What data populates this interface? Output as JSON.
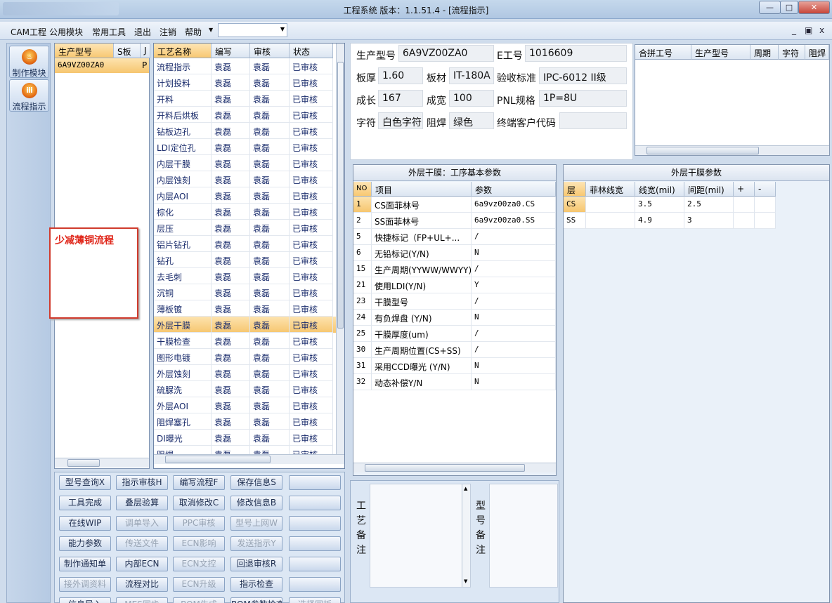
{
  "window": {
    "title": "工程系统  版本：1.1.51.4 - [流程指示]",
    "controls": [
      "—",
      "□",
      "✕"
    ]
  },
  "menubar": {
    "items": [
      "CAM工程",
      "公用模块",
      "常用工具",
      "退出",
      "注销",
      "帮助"
    ],
    "combo_value": "",
    "mdi_controls": [
      "_",
      "▣",
      "x"
    ]
  },
  "toolbar": {
    "items": [
      {
        "label": "制作模块",
        "icon": "flame-icon"
      },
      {
        "label": "流程指示",
        "icon": "flow-icon"
      }
    ]
  },
  "model_list": {
    "headers": [
      "生产型号",
      "S板",
      "J"
    ],
    "rows": [
      [
        "6A9VZ00ZA0",
        "",
        "P"
      ]
    ]
  },
  "note": {
    "text": "少减薄铜流程"
  },
  "process": {
    "headers": [
      "工艺名称",
      "编写",
      "审核",
      "状态"
    ],
    "rows": [
      [
        "流程指示",
        "袁磊",
        "袁磊",
        "已审核"
      ],
      [
        "计划投料",
        "袁磊",
        "袁磊",
        "已审核"
      ],
      [
        "开料",
        "袁磊",
        "袁磊",
        "已审核"
      ],
      [
        "开料后烘板",
        "袁磊",
        "袁磊",
        "已审核"
      ],
      [
        "钻板边孔",
        "袁磊",
        "袁磊",
        "已审核"
      ],
      [
        "LDI定位孔",
        "袁磊",
        "袁磊",
        "已审核"
      ],
      [
        "内层干膜",
        "袁磊",
        "袁磊",
        "已审核"
      ],
      [
        "内层蚀刻",
        "袁磊",
        "袁磊",
        "已审核"
      ],
      [
        "内层AOI",
        "袁磊",
        "袁磊",
        "已审核"
      ],
      [
        "棕化",
        "袁磊",
        "袁磊",
        "已审核"
      ],
      [
        "层压",
        "袁磊",
        "袁磊",
        "已审核"
      ],
      [
        "铝片钻孔",
        "袁磊",
        "袁磊",
        "已审核"
      ],
      [
        "钻孔",
        "袁磊",
        "袁磊",
        "已审核"
      ],
      [
        "去毛刺",
        "袁磊",
        "袁磊",
        "已审核"
      ],
      [
        "沉铜",
        "袁磊",
        "袁磊",
        "已审核"
      ],
      [
        "薄板镀",
        "袁磊",
        "袁磊",
        "已审核"
      ],
      [
        "外层干膜",
        "袁磊",
        "袁磊",
        "已审核"
      ],
      [
        "干膜检查",
        "袁磊",
        "袁磊",
        "已审核"
      ],
      [
        "图形电镀",
        "袁磊",
        "袁磊",
        "已审核"
      ],
      [
        "外层蚀刻",
        "袁磊",
        "袁磊",
        "已审核"
      ],
      [
        "硫脲洗",
        "袁磊",
        "袁磊",
        "已审核"
      ],
      [
        "外层AOI",
        "袁磊",
        "袁磊",
        "已审核"
      ],
      [
        "阻焊塞孔",
        "袁磊",
        "袁磊",
        "已审核"
      ],
      [
        "DI曝光",
        "袁磊",
        "袁磊",
        "已审核"
      ],
      [
        "阻焊",
        "袁磊",
        "袁磊",
        "已审核"
      ]
    ]
  },
  "buttons": [
    [
      "型号查询X",
      "指示审核H",
      "编写流程F",
      "保存信息S",
      ""
    ],
    [
      "工具完成",
      "叠层验算",
      "取消修改C",
      "修改信息B",
      ""
    ],
    [
      "在线WIP",
      "调单导入",
      "PPC审核",
      "型号上网W",
      ""
    ],
    [
      "能力参数",
      "传送文件",
      "ECN影响",
      "发送指示Y",
      ""
    ],
    [
      "制作通知单",
      "内部ECN",
      "ECN文控",
      "回退审核R",
      ""
    ],
    [
      "接外调资料",
      "流程对比",
      "ECN升级",
      "指示检查",
      ""
    ],
    [
      "信息导入",
      "MES同步",
      "BOM生成",
      "BOM参数检查",
      "选择同板"
    ]
  ],
  "info": {
    "labels": {
      "model": "生产型号",
      "e_no": "E工号",
      "thickness": "板厚",
      "material": "板材",
      "standard": "验收标准",
      "length": "成长",
      "width": "成宽",
      "pnl": "PNL规格",
      "char": "字符",
      "mask": "阻焊",
      "customer": "终端客户代码"
    },
    "values": {
      "model": "6A9VZ00ZA0",
      "e_no": "1016609",
      "thickness": "1.60",
      "material": "IT-180A",
      "standard": "IPC-6012 II级",
      "length": "167",
      "width": "100",
      "pnl": "1P=8U",
      "char": "白色字符",
      "mask": "绿色",
      "customer": ""
    }
  },
  "combined": {
    "headers": [
      "合拼工号",
      "生产型号",
      "周期",
      "字符",
      "阻焊"
    ]
  },
  "params": {
    "title": "外层干膜：工序基本参数",
    "headers": [
      "NO",
      "项目",
      "参数"
    ],
    "rows": [
      [
        "1",
        "CS面菲林号",
        "6a9vz00za0.CS"
      ],
      [
        "2",
        "SS面菲林号",
        "6a9vz00za0.SS"
      ],
      [
        "5",
        "快捷标记（FP+UL+...",
        "/"
      ],
      [
        "6",
        "无铅标记(Y/N)",
        "N"
      ],
      [
        "15",
        "生产周期(YYWW/WWYY)",
        "/"
      ],
      [
        "21",
        "使用LDI(Y/N)",
        "Y"
      ],
      [
        "23",
        "干膜型号",
        "/"
      ],
      [
        "24",
        "有负焊盘 (Y/N)",
        "N"
      ],
      [
        "25",
        "干膜厚度(um)",
        "/"
      ],
      [
        "30",
        "生产周期位置(CS+SS)",
        "/"
      ],
      [
        "31",
        "采用CCD曝光 (Y/N)",
        "N"
      ],
      [
        "32",
        "动态补偿Y/N",
        "N"
      ]
    ]
  },
  "film": {
    "title": "外层干膜参数",
    "headers": [
      "层",
      "菲林线宽",
      "线宽(mil)",
      "间距(mil)",
      "+",
      "-"
    ],
    "rows": [
      [
        "CS",
        "",
        "3.5",
        "2.5",
        "",
        ""
      ],
      [
        "SS",
        "",
        "4.9",
        "3",
        "",
        ""
      ]
    ]
  },
  "remarks": {
    "process_label": "工艺备注",
    "model_label": "型号备注"
  }
}
